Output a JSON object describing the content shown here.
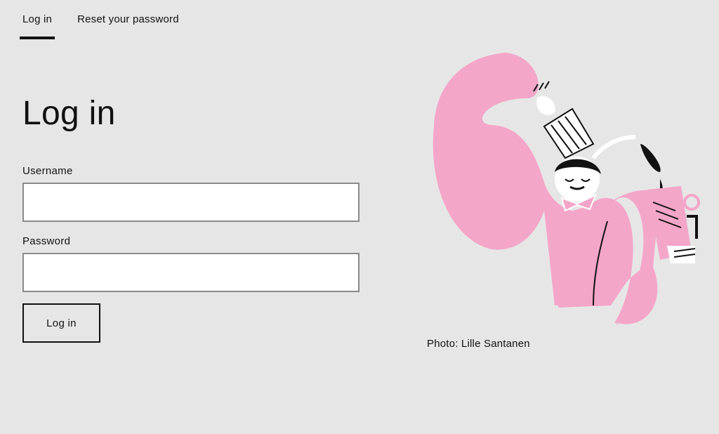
{
  "tabs": [
    {
      "label": "Log in",
      "active": true
    },
    {
      "label": "Reset your password",
      "active": false
    }
  ],
  "page_title": "Log in",
  "form": {
    "username_label": "Username",
    "username_value": "",
    "password_label": "Password",
    "password_value": "",
    "submit_label": "Log in"
  },
  "illustration": {
    "icon": "chef-pouring-coffee-illustration",
    "caption": "Photo: Lille Santanen"
  },
  "colors": {
    "background": "#e6e6e6",
    "accent_pink": "#f4a6c8",
    "text": "#111111"
  }
}
